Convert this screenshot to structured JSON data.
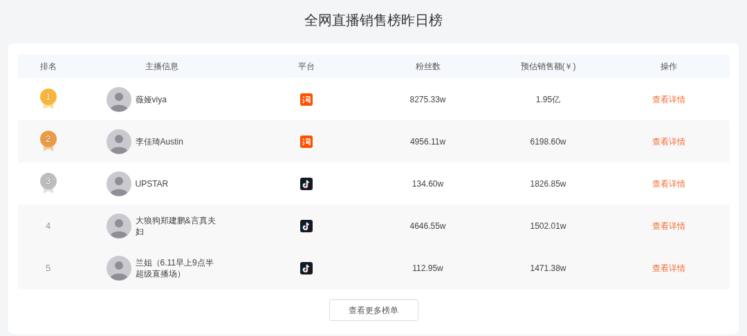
{
  "title": "全网直播销售榜昨日榜",
  "table": {
    "columns": [
      "排名",
      "主播信息",
      "平台",
      "粉丝数",
      "预估销售额(￥)",
      "操作"
    ],
    "rows": [
      {
        "rank": {
          "text": "1",
          "kind": "medal",
          "color": "#f9b53a"
        },
        "name": "薇娅viya",
        "platform": {
          "kind": "taobao"
        },
        "fans": "8275.33w",
        "sales": "1.95亿",
        "action": "查看详情"
      },
      {
        "rank": {
          "text": "2",
          "kind": "medal",
          "color": "#eb9a45"
        },
        "name": "李佳琦Austin",
        "platform": {
          "kind": "taobao"
        },
        "fans": "4956.11w",
        "sales": "6198.60w",
        "action": "查看详情"
      },
      {
        "rank": {
          "text": "3",
          "kind": "medal",
          "color": "#bdbdbd"
        },
        "name": "UPSTAR",
        "platform": {
          "kind": "douyin"
        },
        "fans": "134.60w",
        "sales": "1826.85w",
        "action": "查看详情"
      },
      {
        "rank": {
          "text": "4",
          "kind": "plain"
        },
        "name": "大狼狗郑建鹏&言真夫妇",
        "platform": {
          "kind": "douyin"
        },
        "fans": "4646.55w",
        "sales": "1502.01w",
        "action": "查看详情"
      },
      {
        "rank": {
          "text": "5",
          "kind": "plain"
        },
        "name": "兰姐（6.11早上9点半超级直播场）",
        "platform": {
          "kind": "douyin"
        },
        "fans": "112.95w",
        "sales": "1471.38w",
        "action": "查看详情"
      }
    ]
  },
  "more_button": "查看更多榜单"
}
